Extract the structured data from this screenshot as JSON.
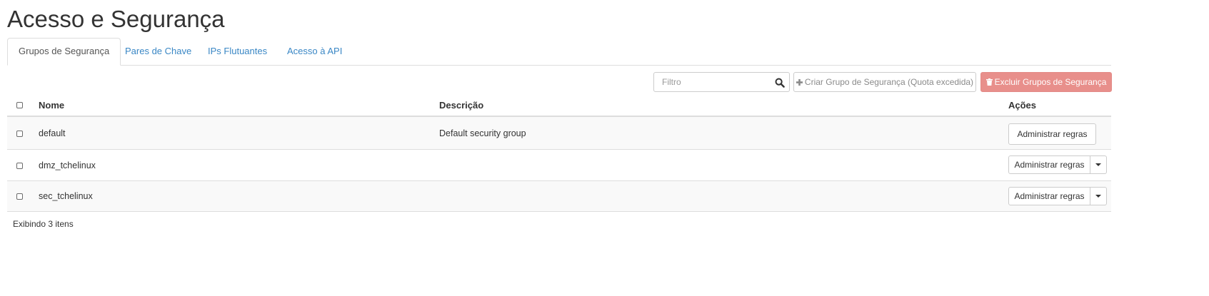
{
  "page": {
    "title": "Acesso e Segurança"
  },
  "tabs": [
    {
      "label": "Grupos de Segurança",
      "active": true
    },
    {
      "label": "Pares de Chave",
      "active": false
    },
    {
      "label": "IPs Flutuantes",
      "active": false
    },
    {
      "label": "Acesso à API",
      "active": false
    }
  ],
  "toolbar": {
    "filter_placeholder": "Filtro",
    "filter_value": "",
    "search_icon": "search-icon",
    "create_label": "Criar Grupo de Segurança (Quota excedida)",
    "create_icon": "plus-icon",
    "delete_label": "Excluir Grupos de Segurança",
    "delete_icon": "trash-icon"
  },
  "table": {
    "columns": [
      "Nome",
      "Descrição",
      "Ações"
    ],
    "rows": [
      {
        "name": "default",
        "description": "Default security group",
        "action": "Administrar regras",
        "has_dropdown": false,
        "checked": false
      },
      {
        "name": "dmz_tchelinux",
        "description": "",
        "action": "Administrar regras",
        "has_dropdown": true,
        "checked": false
      },
      {
        "name": "sec_tchelinux",
        "description": "",
        "action": "Administrar regras",
        "has_dropdown": true,
        "checked": false
      }
    ]
  },
  "footer": {
    "count_text": "Exibindo 3 itens"
  },
  "colors": {
    "link": "#3a87c5",
    "danger": "#e88f8b",
    "border": "#dddddd",
    "stripe": "#f9f9f9"
  }
}
